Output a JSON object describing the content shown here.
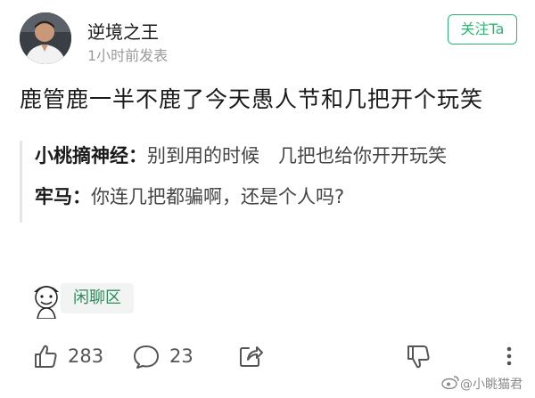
{
  "author": {
    "name": "逆境之王",
    "time": "1小时前发表"
  },
  "follow_label": "关注Ta",
  "post": {
    "text": "鹿管鹿一半不鹿了今天愚人节和几把开个玩笑"
  },
  "quotes": [
    {
      "user": "小桃摘神经：",
      "text": "别到用的时候　几把也给你开开玩笑"
    },
    {
      "user": "牢马：",
      "text": "你连几把都骗啊，还是个人吗?"
    }
  ],
  "topic": {
    "label": "闲聊区"
  },
  "actions": {
    "likes": "283",
    "comments": "23"
  },
  "watermark": "@小眺猫君"
}
